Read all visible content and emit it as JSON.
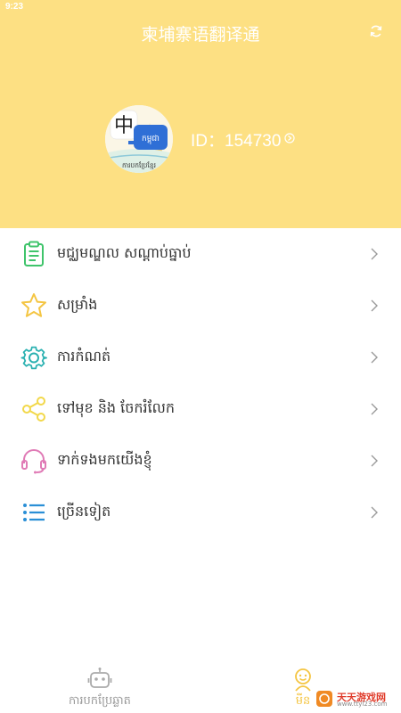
{
  "status_bar": {
    "time": "9:23"
  },
  "header": {
    "title": "柬埔寨语翻译通",
    "refresh_icon": "refresh-icon"
  },
  "profile": {
    "id_text": "ID：154730",
    "avatar_glyph": "中",
    "avatar_khmer": "កម្ពុជា",
    "avatar_caption": "ការបកប្រែខ្មែរ"
  },
  "menu": {
    "items": [
      {
        "label": "មជ្ឈមណ្ឌល សណ្ដាប់ធ្នាប់",
        "icon": "clipboard-icon",
        "color": "#3fc46b"
      },
      {
        "label": "សម្រាំង",
        "icon": "star-icon",
        "color": "#f4c542"
      },
      {
        "label": "ការកំណត់",
        "icon": "gear-icon",
        "color": "#2bb1b1"
      },
      {
        "label": "ទៅមុខ និង ចែករំលែក",
        "icon": "share-icon",
        "color": "#f2d84a"
      },
      {
        "label": "ទាក់ទងមកយើងខ្ញុំ",
        "icon": "headset-icon",
        "color": "#e07bb6"
      },
      {
        "label": "ច្រើនទៀត",
        "icon": "list-icon",
        "color": "#2a8fd6"
      }
    ]
  },
  "tabbar": {
    "tabs": [
      {
        "label": "ការបកប្រែឆ្លាត",
        "icon": "robot-icon",
        "active": false
      },
      {
        "label": "មីន",
        "icon": "smiley-icon",
        "active": true
      }
    ]
  },
  "watermark": {
    "text": "天天游戏网",
    "url": "www.ttyl23.com"
  },
  "colors": {
    "header_bg": "#fde083",
    "active_tab": "#f4c542",
    "inactive_tab": "#999999"
  }
}
